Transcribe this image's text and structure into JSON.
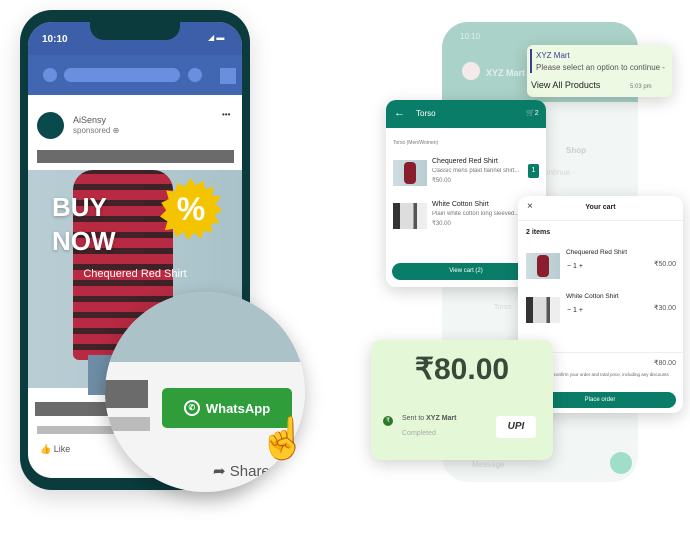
{
  "ad_phone": {
    "time": "10:10",
    "advertiser": "AiSensy",
    "sponsored": "sponsored",
    "more": "•••",
    "headline_1": "BUY",
    "headline_2": "NOW",
    "badge": "%",
    "product": "Chequered Red Shirt",
    "like": "Like",
    "share": "Share",
    "cta": "WhatsApp"
  },
  "chat": {
    "contact": "XYZ Mart",
    "time": "10:10",
    "bubble": {
      "sender": "XYZ Mart",
      "text": "Please select an option to continue -",
      "button": "View All Products",
      "time": "5:03 pm"
    },
    "bg_shop": "Shop",
    "bg_continue": "continue -",
    "bg_torso": "Torso",
    "bg_message": "Message"
  },
  "catalog": {
    "title": "Torso",
    "cart_count": "2",
    "section": "Torso (Men/Women)",
    "items": [
      {
        "name": "Chequered Red Shirt",
        "desc": "Classic mens plaid flannel shirt...",
        "price": "₹50.00",
        "qty": "1"
      },
      {
        "name": "White Cotton Shirt",
        "desc": "Plain white cotton long sleeved...",
        "price": "₹30.00"
      }
    ],
    "view_cart": "View cart (2)"
  },
  "cart": {
    "title": "Your cart",
    "count": "2 items",
    "items": [
      {
        "name": "Chequered Red Shirt",
        "qty": "1",
        "price": "₹50.00"
      },
      {
        "name": "White Cotton Shirt",
        "qty": "1",
        "price": "₹30.00"
      }
    ],
    "total": "₹80.00",
    "note": "XYZ Mart will confirm your order and total price, including any discounts",
    "place_order": "Place order"
  },
  "payment": {
    "amount": "₹80.00",
    "sent_to_prefix": "Sent to ",
    "recipient": "XYZ Mart",
    "status": "Completed",
    "logo": "UPI"
  },
  "colors": {
    "facebook_blue": "#4267b2",
    "whatsapp_green": "#2e9d3a",
    "teal": "#0a7d68",
    "payment_bg": "#e4f8d8"
  }
}
